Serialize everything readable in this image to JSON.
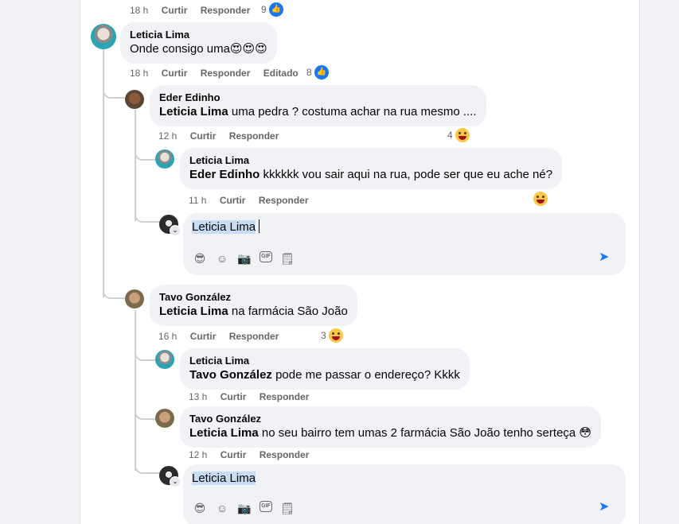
{
  "comments": {
    "top_meta": {
      "time": "18 h",
      "curtir": "Curtir",
      "responder": "Responder",
      "count": "9"
    },
    "c1": {
      "author": "Leticia Lima",
      "text": "Onde consigo uma😍😍😍",
      "time": "18 h",
      "curtir": "Curtir",
      "responder": "Responder",
      "edited": "Editado",
      "count": "8"
    },
    "c2": {
      "author": "Eder Edinho",
      "mention": "Leticia Lima",
      "text": " uma pedra ? costuma achar na rua mesmo ....",
      "time": "12 h",
      "curtir": "Curtir",
      "responder": "Responder",
      "count": "4"
    },
    "c3": {
      "author": "Leticia Lima",
      "mention": "Eder Edinho",
      "text": " kkkkkk vou sair aqui na rua, pode ser que eu ache né?",
      "time": "11 h",
      "curtir": "Curtir",
      "responder": "Responder"
    },
    "reply1": {
      "value": "Leticia Lima"
    },
    "c4": {
      "author": "Tavo González",
      "mention": "Leticia Lima",
      "text": " na farmácia São João",
      "time": "16 h",
      "curtir": "Curtir",
      "responder": "Responder",
      "count": "3"
    },
    "c5": {
      "author": "Leticia Lima",
      "mention": "Tavo González",
      "text": " pode me passar o endereço? Kkkk",
      "time": "13 h",
      "curtir": "Curtir",
      "responder": "Responder"
    },
    "c6": {
      "author": "Tavo González",
      "mention": "Leticia Lima",
      "text": " no seu bairro tem umas 2 farmácia São João tenho serteça 😳",
      "time": "12 h",
      "curtir": "Curtir",
      "responder": "Responder"
    },
    "reply2": {
      "value": "Leticia Lima"
    }
  },
  "icons": {
    "avatar_sticker": "😎",
    "emoji": "☺",
    "camera": "📷",
    "gif": "GIF",
    "sticker": "🗒",
    "send": "➤",
    "like": "👍",
    "badge": "⌄"
  },
  "colors": {
    "accent": "#1877f2",
    "bubble": "#f0f2f5",
    "muted": "#65676b"
  }
}
